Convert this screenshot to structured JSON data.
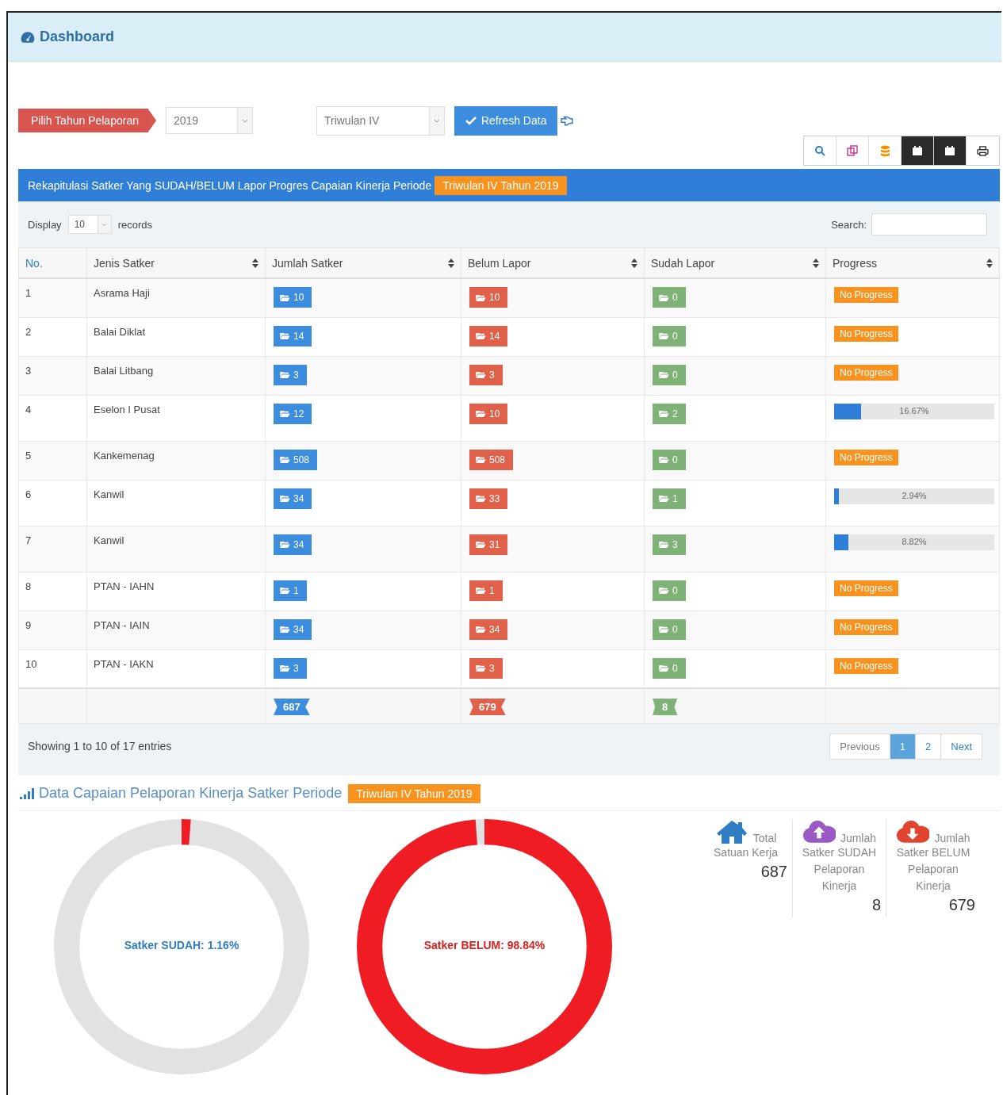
{
  "header": {
    "title": "Dashboard"
  },
  "filters": {
    "year_label": "Pilih Tahun Pelaporan",
    "year": "2019",
    "period": "Triwulan IV",
    "refresh_button": "Refresh Data"
  },
  "panel": {
    "title": "Rekapitulasi Satker Yang SUDAH/BELUM Lapor Progres Capaian Kinerja Periode",
    "period_tag": "Triwulan IV Tahun 2019"
  },
  "length": {
    "label": "Display",
    "value": "10",
    "suffix": "records"
  },
  "search": {
    "label": "Search:"
  },
  "table": {
    "columns": [
      "No.",
      "Jenis Satker",
      "Jumlah Satker",
      "Belum Lapor",
      "Sudah Lapor",
      "Progress"
    ],
    "rows": [
      {
        "no": "1",
        "jenis": "Asrama Haji",
        "jumlah": "10",
        "belum": "10",
        "sudah": "0",
        "progress": {
          "kind": "none",
          "label": "No Progress"
        }
      },
      {
        "no": "2",
        "jenis": "Balai Diklat",
        "jumlah": "14",
        "belum": "14",
        "sudah": "0",
        "progress": {
          "kind": "none",
          "label": "No Progress"
        }
      },
      {
        "no": "3",
        "jenis": "Balai Litbang",
        "jumlah": "3",
        "belum": "3",
        "sudah": "0",
        "progress": {
          "kind": "none",
          "label": "No Progress"
        }
      },
      {
        "no": "4",
        "jenis": "Eselon I Pusat",
        "jumlah": "12",
        "belum": "10",
        "sudah": "2",
        "progress": {
          "kind": "bar",
          "level": 0.1667,
          "label": "16.67%"
        }
      },
      {
        "no": "5",
        "jenis": "Kankemenag",
        "jumlah": "508",
        "belum": "508",
        "sudah": "0",
        "progress": {
          "kind": "none",
          "label": "No Progress"
        }
      },
      {
        "no": "6",
        "jenis": "Kanwil",
        "jumlah": "34",
        "belum": "33",
        "sudah": "1",
        "progress": {
          "kind": "bar",
          "level": 0.0294,
          "label": "2.94%"
        }
      },
      {
        "no": "7",
        "jenis": "Kanwil",
        "jumlah": "34",
        "belum": "31",
        "sudah": "3",
        "progress": {
          "kind": "bar",
          "level": 0.0882,
          "label": "8.82%"
        }
      },
      {
        "no": "8",
        "jenis": "PTAN - IAHN",
        "jumlah": "1",
        "belum": "1",
        "sudah": "0",
        "progress": {
          "kind": "none",
          "label": "No Progress"
        }
      },
      {
        "no": "9",
        "jenis": "PTAN - IAIN",
        "jumlah": "34",
        "belum": "34",
        "sudah": "0",
        "progress": {
          "kind": "none",
          "label": "No Progress"
        }
      },
      {
        "no": "10",
        "jenis": "PTAN - IAKN",
        "jumlah": "3",
        "belum": "3",
        "sudah": "0",
        "progress": {
          "kind": "none",
          "label": "No Progress"
        }
      }
    ],
    "totals": {
      "jumlah": "687",
      "belum": "679",
      "sudah": "8"
    }
  },
  "footer": {
    "info": "Showing 1 to 10 of 17 entries",
    "pages": [
      {
        "label": "Previous",
        "selected": false
      },
      {
        "label": "1",
        "selected": true
      },
      {
        "label": "2",
        "selected": false
      },
      {
        "label": "Next",
        "selected": false
      }
    ]
  },
  "chart_section": {
    "title": "Data Capaian Pelaporan Kinerja Satker Periode",
    "period_tag": "Triwulan IV Tahun 2019"
  },
  "donuts": [
    {
      "label": "Satker SUDAH: 1.16%",
      "level": 0.0116,
      "color": "#ef1c24",
      "kind": "sudah"
    },
    {
      "label": "Satker BELUM: 98.84%",
      "level": 0.9884,
      "color": "#ef1c24",
      "kind": "belum"
    }
  ],
  "stats": [
    {
      "kind": "home",
      "title_first": "Total",
      "title_rest": "Satuan Kerja",
      "value": "687"
    },
    {
      "kind": "upload",
      "title_first": "Jumlah",
      "title_rest": "Satker SUDAH Pelaporan Kinerja",
      "value": "8"
    },
    {
      "kind": "download",
      "title_first": "Jumlah",
      "title_rest": "Satker BELUM Pelaporan Kinerja",
      "value": "679"
    }
  ]
}
